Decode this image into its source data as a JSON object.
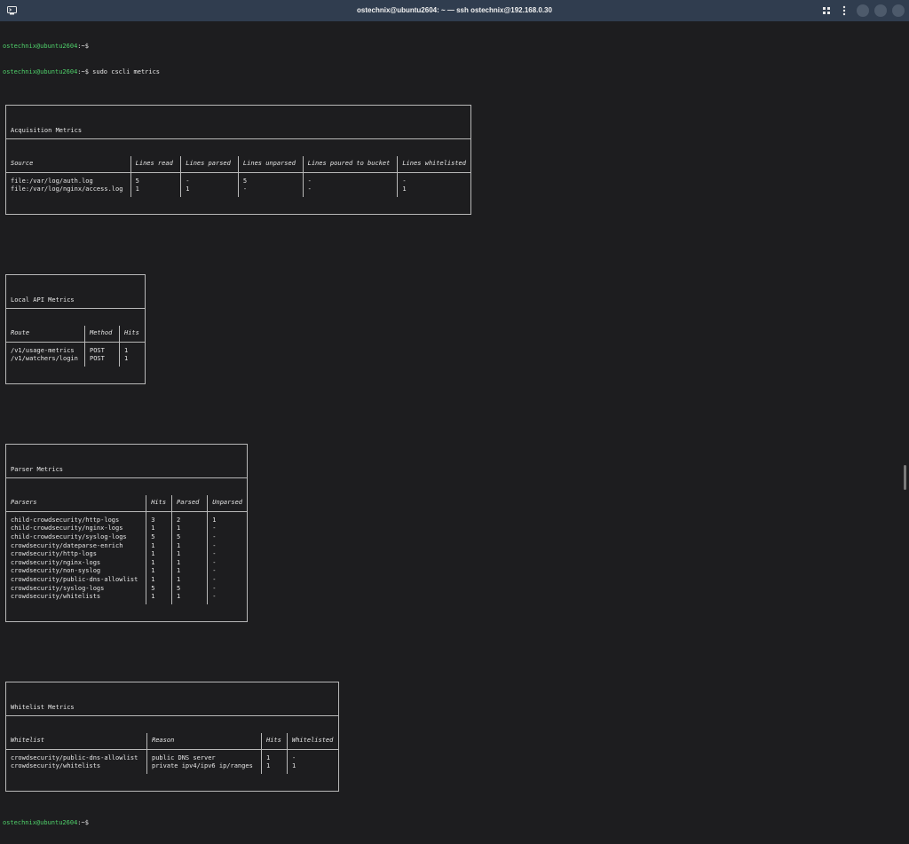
{
  "window": {
    "title": "ostechnix@ubuntu2604: ~ — ssh ostechnix@192.168.0.30",
    "icons": {
      "app": "terminal-icon",
      "grid": "grid-icon",
      "menu": "kebab-menu-icon"
    }
  },
  "prompt": {
    "user_host": "ostechnix@ubuntu2604",
    "path": ":~$"
  },
  "command": " sudo cscli metrics",
  "acquisition": {
    "title": "Acquisition Metrics",
    "headers": [
      "Source",
      "Lines read",
      "Lines parsed",
      "Lines unparsed",
      "Lines poured to bucket",
      "Lines whitelisted"
    ],
    "rows": [
      [
        "file:/var/log/auth.log",
        "5",
        "-",
        "5",
        "-",
        "-"
      ],
      [
        "file:/var/log/nginx/access.log",
        "1",
        "1",
        "-",
        "-",
        "1"
      ]
    ]
  },
  "local_api": {
    "title": "Local API Metrics",
    "headers": [
      "Route",
      "Method",
      "Hits"
    ],
    "rows": [
      [
        "/v1/usage-metrics",
        "POST",
        "1"
      ],
      [
        "/v1/watchers/login",
        "POST",
        "1"
      ]
    ]
  },
  "parser": {
    "title": "Parser Metrics",
    "headers": [
      "Parsers",
      "Hits",
      "Parsed",
      "Unparsed"
    ],
    "rows": [
      [
        "child-crowdsecurity/http-logs",
        "3",
        "2",
        "1"
      ],
      [
        "child-crowdsecurity/nginx-logs",
        "1",
        "1",
        "-"
      ],
      [
        "child-crowdsecurity/syslog-logs",
        "5",
        "5",
        "-"
      ],
      [
        "crowdsecurity/dateparse-enrich",
        "1",
        "1",
        "-"
      ],
      [
        "crowdsecurity/http-logs",
        "1",
        "1",
        "-"
      ],
      [
        "crowdsecurity/nginx-logs",
        "1",
        "1",
        "-"
      ],
      [
        "crowdsecurity/non-syslog",
        "1",
        "1",
        "-"
      ],
      [
        "crowdsecurity/public-dns-allowlist",
        "1",
        "1",
        "-"
      ],
      [
        "crowdsecurity/syslog-logs",
        "5",
        "5",
        "-"
      ],
      [
        "crowdsecurity/whitelists",
        "1",
        "1",
        "-"
      ]
    ]
  },
  "whitelist": {
    "title": "Whitelist Metrics",
    "headers": [
      "Whitelist",
      "Reason",
      "Hits",
      "Whitelisted"
    ],
    "rows": [
      [
        "crowdsecurity/public-dns-allowlist",
        "public DNS server",
        "1",
        "-"
      ],
      [
        "crowdsecurity/whitelists",
        "private ipv4/ipv6 ip/ranges",
        "1",
        "1"
      ]
    ]
  }
}
